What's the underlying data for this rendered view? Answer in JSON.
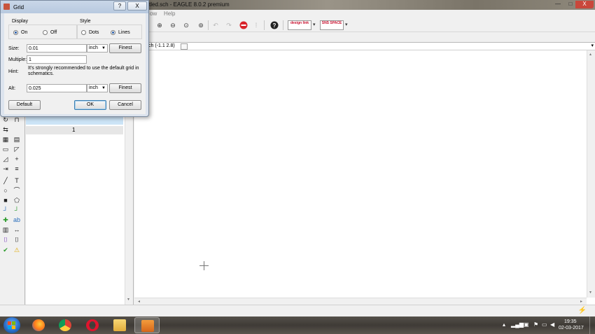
{
  "app": {
    "title": "tled.sch - EAGLE 8.0.2 premium",
    "window_controls": {
      "minimize": "—",
      "maximize": "□",
      "close": "X"
    },
    "menu": {
      "window": "ow",
      "help": "Help"
    },
    "toolbar": {
      "icons": [
        "zoom-in-icon",
        "zoom-out-icon",
        "zoom-fit-icon",
        "zoom-select-icon",
        "undo-icon",
        "redo-icon",
        "stop-icon",
        "go-icon",
        "help-icon"
      ],
      "design_link_label": "design link",
      "sns_label": "SNS SPACE",
      "brand_color": "#c8102e"
    },
    "coord_readout": "ch (-1.1 2.8)",
    "sheet_number": "1"
  },
  "grid_dialog": {
    "title": "Grid",
    "help_btn": "?",
    "close_btn": "X",
    "display": {
      "label": "Display",
      "on": "On",
      "off": "Off",
      "selected": "On"
    },
    "style": {
      "label": "Style",
      "dots": "Dots",
      "lines": "Lines",
      "selected": "Lines"
    },
    "size": {
      "label": "Size:",
      "value": "0.01",
      "unit": "inch",
      "finest": "Finest"
    },
    "multiple": {
      "label": "Multiple:",
      "value": "1"
    },
    "hint": {
      "label": "Hint:",
      "text": "It's strongly recommended to use the default grid in schematics."
    },
    "alt": {
      "label": "Alt:",
      "value": "0.025",
      "unit": "inch",
      "finest": "Finest"
    },
    "buttons": {
      "default": "Default",
      "ok": "OK",
      "cancel": "Cancel"
    }
  },
  "taskbar": {
    "apps": [
      "firefox",
      "chrome",
      "opera",
      "file-explorer",
      "eagle"
    ],
    "clock_time": "19:35",
    "clock_date": "02-03-2017"
  }
}
